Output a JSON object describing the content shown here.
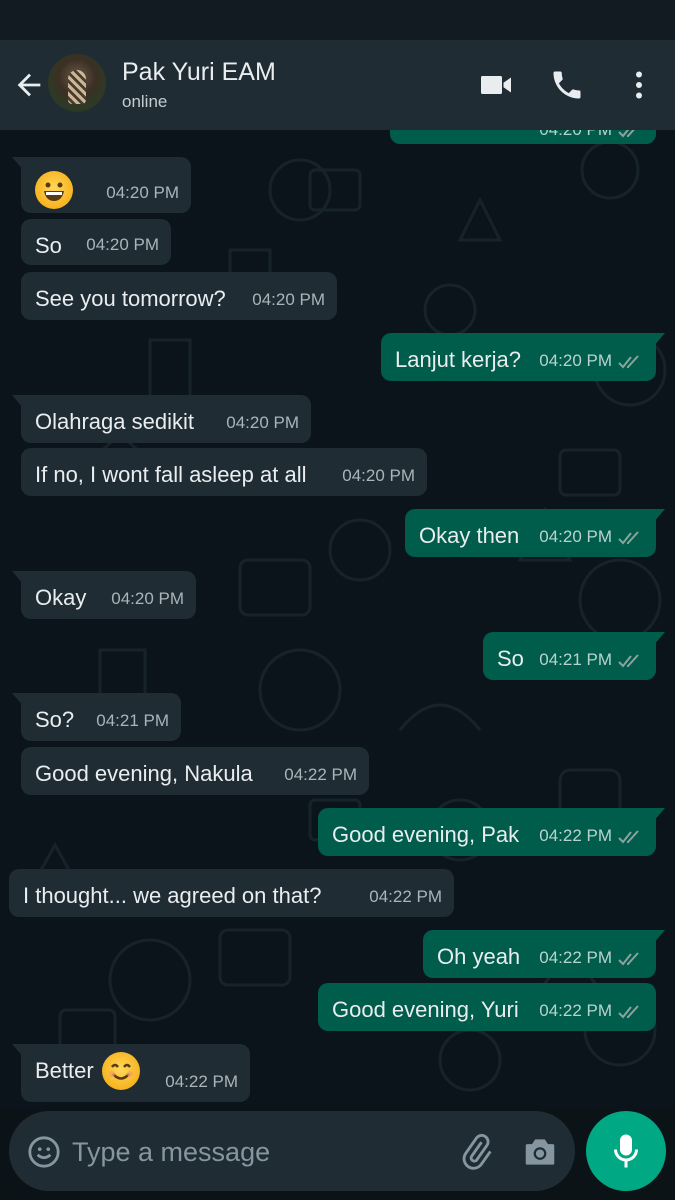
{
  "contact": {
    "name": "Pak Yuri EAM",
    "status": "online"
  },
  "input": {
    "placeholder": "Type a message"
  },
  "top_partial_time": "04:20 PM",
  "messages": [
    {
      "dir": "in",
      "text": "",
      "emoji": "grinning-face-icon",
      "time": "04:20 PM"
    },
    {
      "dir": "in",
      "text": "So",
      "time": "04:20 PM"
    },
    {
      "dir": "in",
      "text": "See you tomorrow?",
      "time": "04:20 PM"
    },
    {
      "dir": "out",
      "text": "Lanjut kerja?",
      "time": "04:20 PM"
    },
    {
      "dir": "in",
      "text": "Olahraga sedikit",
      "time": "04:20 PM"
    },
    {
      "dir": "in",
      "text": "If no, I wont fall asleep at all",
      "time": "04:20 PM"
    },
    {
      "dir": "out",
      "text": "Okay then",
      "time": "04:20 PM"
    },
    {
      "dir": "in",
      "text": "Okay",
      "time": "04:20 PM"
    },
    {
      "dir": "out",
      "text": "So",
      "time": "04:21 PM"
    },
    {
      "dir": "in",
      "text": "So?",
      "time": "04:21 PM"
    },
    {
      "dir": "in",
      "text": "Good evening, Nakula",
      "time": "04:22 PM"
    },
    {
      "dir": "out",
      "text": "Good evening, Pak",
      "time": "04:22 PM"
    },
    {
      "dir": "in",
      "text": "I thought... we agreed on that?",
      "time": "04:22 PM"
    },
    {
      "dir": "out",
      "text": "Oh yeah",
      "time": "04:22 PM"
    },
    {
      "dir": "out",
      "text": "Good evening, Yuri",
      "time": "04:22 PM"
    },
    {
      "dir": "in",
      "text": "Better",
      "emoji": "smiling-face-icon",
      "time": "04:22 PM"
    }
  ],
  "colors": {
    "header_bg": "#1f2c34",
    "chat_bg": "#0b141a",
    "incoming_bubble": "#1f2c34",
    "outgoing_bubble": "#005c4b",
    "accent": "#00a884",
    "read_ticks": "#8aa39c"
  }
}
